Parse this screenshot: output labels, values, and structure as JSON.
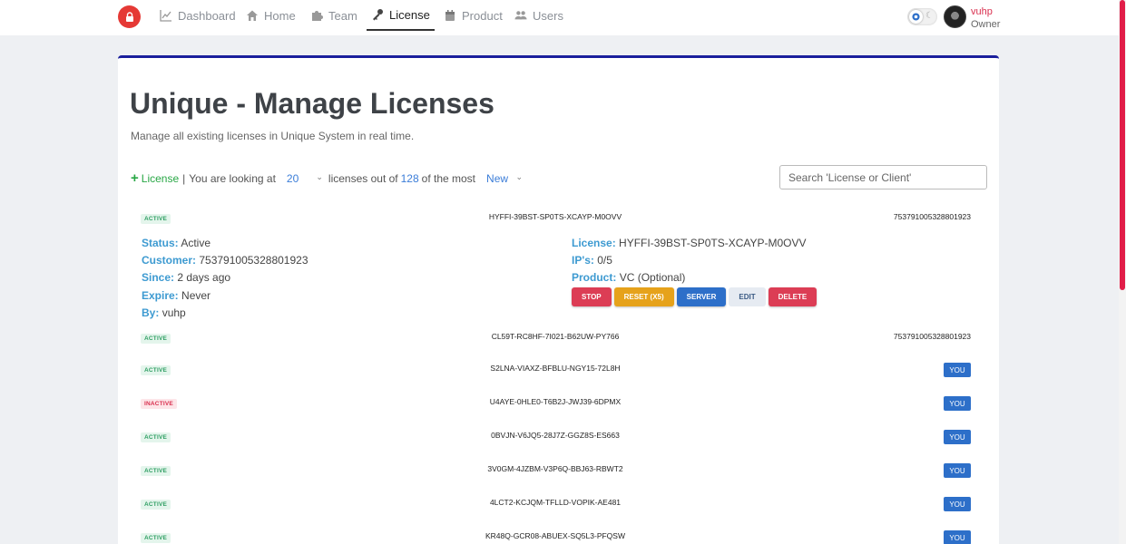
{
  "colors": {
    "accent": "#1a1f9c",
    "brand": "#e53935",
    "active_green": "#2e9e62",
    "inactive_red": "#d9304f",
    "link_blue": "#3b7dd8"
  },
  "nav": {
    "items": [
      {
        "label": "Dashboard",
        "icon": "chart-line-icon"
      },
      {
        "label": "Home",
        "icon": "home-icon"
      },
      {
        "label": "Team",
        "icon": "puzzle-icon"
      },
      {
        "label": "License",
        "icon": "key-icon",
        "active": true
      },
      {
        "label": "Product",
        "icon": "calendar-icon"
      },
      {
        "label": "Users",
        "icon": "users-icon"
      }
    ],
    "user": {
      "name": "vuhp",
      "role": "Owner"
    }
  },
  "page": {
    "title": "Unique - Manage Licenses",
    "subtitle": "Manage all existing licenses in Unique System in real time."
  },
  "filter": {
    "add_label": "License",
    "separator": "|",
    "text1": "You are looking at",
    "count": "20",
    "text2": "licenses out of",
    "total": "128",
    "text3": "of the most",
    "sort": "New",
    "search_placeholder": "Search 'License or Client'"
  },
  "expanded": {
    "status_label": "Status:",
    "status": "Active",
    "customer_label": "Customer:",
    "customer": "753791005328801923",
    "since_label": "Since:",
    "since": "2 days ago",
    "expire_label": "Expire:",
    "expire": "Never",
    "by_label": "By:",
    "by": "vuhp",
    "license_label": "License:",
    "license": "HYFFI-39BST-SP0TS-XCAYP-M0OVV",
    "ips_label": "IP's:",
    "ips": "0/5",
    "product_label": "Product:",
    "product": "VC (Optional)",
    "actions": {
      "stop": "STOP",
      "reset": "RESET (X5)",
      "server": "SERVER",
      "edit": "EDIT",
      "delete": "DELETE"
    }
  },
  "rows": [
    {
      "status": "ACTIVE",
      "key": "HYFFI-39BST-SP0TS-XCAYP-M0OVV",
      "owner": "753791005328801923"
    },
    {
      "status": "ACTIVE",
      "key": "CL59T-RC8HF-7I021-B62UW-PY766",
      "owner": "753791005328801923"
    },
    {
      "status": "ACTIVE",
      "key": "S2LNA-VIAXZ-BFBLU-NGY15-72L8H",
      "owner": "YOU"
    },
    {
      "status": "INACTIVE",
      "key": "U4AYE-0HLE0-T6B2J-JWJ39-6DPMX",
      "owner": "YOU"
    },
    {
      "status": "ACTIVE",
      "key": "0BVJN-V6JQ5-28J7Z-GGZ8S-ES663",
      "owner": "YOU"
    },
    {
      "status": "ACTIVE",
      "key": "3V0GM-4JZBM-V3P6Q-BBJ63-RBWT2",
      "owner": "YOU"
    },
    {
      "status": "ACTIVE",
      "key": "4LCT2-KCJQM-TFLLD-VOPIK-AE481",
      "owner": "YOU"
    },
    {
      "status": "ACTIVE",
      "key": "KR48Q-GCR08-ABUEX-SQ5L3-PFQSW",
      "owner": "YOU"
    }
  ]
}
